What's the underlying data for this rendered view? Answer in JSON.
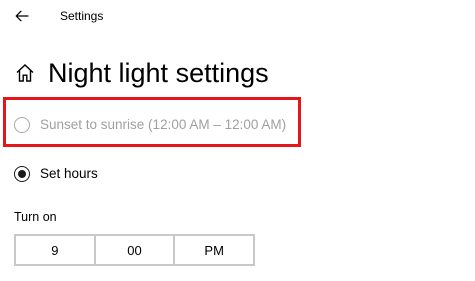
{
  "titlebar": {
    "back_icon": "back-arrow-icon",
    "app_title": "Settings"
  },
  "page": {
    "home_icon": "home-icon",
    "title": "Night light settings"
  },
  "schedule": {
    "options": [
      {
        "label": "Sunset to sunrise (12:00 AM – 12:00 AM)",
        "selected": false,
        "disabled": true
      },
      {
        "label": "Set hours",
        "selected": true,
        "disabled": false
      }
    ]
  },
  "turn_on": {
    "label": "Turn on",
    "hour": "9",
    "minute": "00",
    "period": "PM"
  },
  "colors": {
    "highlight": "#e8141b",
    "disabled_text": "#a0a0a0",
    "border": "#c8c8c8"
  }
}
